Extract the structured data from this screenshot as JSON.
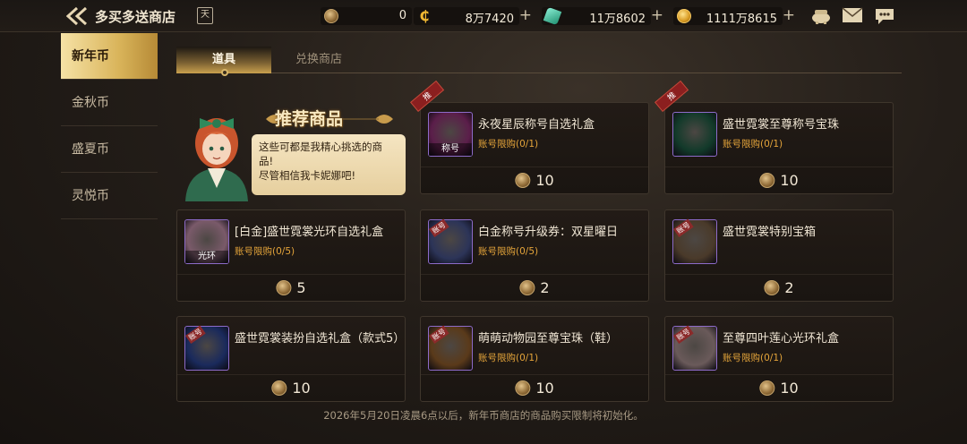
{
  "header": {
    "title": "多买多送商店",
    "calendar_glyph": "天",
    "currencies": [
      {
        "icon": "bronze-coin-icon",
        "value": "0"
      },
      {
        "icon": "c-coin-icon",
        "value": "8万7420"
      },
      {
        "icon": "green-gem-icon",
        "value": "11万8602"
      },
      {
        "icon": "gold-coin-icon",
        "value": "1111万8615"
      }
    ],
    "plus": "+"
  },
  "sidebar": {
    "items": [
      {
        "label": "新年币",
        "active": true
      },
      {
        "label": "金秋币"
      },
      {
        "label": "盛夏币"
      },
      {
        "label": "灵悦币"
      }
    ]
  },
  "tabs": [
    {
      "label": "道具",
      "active": true
    },
    {
      "label": "兑换商店"
    }
  ],
  "recommend": {
    "title": "推荐商品",
    "bubble_line1": "这些可都是我精心挑选的商",
    "bubble_line2": "品!",
    "bubble_line3": "尽管相信我卡妮娜吧!"
  },
  "products": [
    {
      "name": "永夜星辰称号自选礼盒",
      "limit": "账号限购(0/1)",
      "price": "10",
      "tag": "推",
      "thumb_label": "称号",
      "thumb_color": "#5b1e4a"
    },
    {
      "name": "盛世霓裳至尊称号宝珠",
      "limit": "账号限购(0/1)",
      "price": "10",
      "tag": "推",
      "thumb_label": "",
      "thumb_color": "#123a2a"
    },
    {
      "name": "[白金]盛世霓裳光环自选礼盒",
      "limit": "账号限购(0/5)",
      "price": "5",
      "thumb_label": "光环",
      "thumb_color": "#7a5a6a"
    },
    {
      "name": "白金称号升级券：双星曜日",
      "limit": "账号限购(0/5)",
      "price": "2",
      "thumb_label": "",
      "thumb_stamp": "账号",
      "thumb_color": "#2c3458"
    },
    {
      "name": "盛世霓裳特别宝箱",
      "limit": "",
      "price": "2",
      "thumb_label": "",
      "thumb_stamp": "账号",
      "thumb_color": "#4a3a2a"
    },
    {
      "name": "盛世霓裳装扮自选礼盒（款式5）",
      "limit": "",
      "price": "10",
      "thumb_label": "",
      "thumb_stamp": "账号",
      "thumb_color": "#1a2a5c"
    },
    {
      "name": "萌萌动物园至尊宝珠（鞋）",
      "limit": "账号限购(0/1)",
      "price": "10",
      "thumb_label": "",
      "thumb_stamp": "账号",
      "thumb_color": "#5a3a1a"
    },
    {
      "name": "至尊四叶莲心光环礼盒",
      "limit": "账号限购(0/1)",
      "price": "10",
      "thumb_label": "",
      "thumb_stamp": "账号",
      "thumb_color": "#6a5a5a"
    }
  ],
  "footer": "2026年5月20日凌晨6点以后，新年币商店的商品购买限制将初始化。"
}
